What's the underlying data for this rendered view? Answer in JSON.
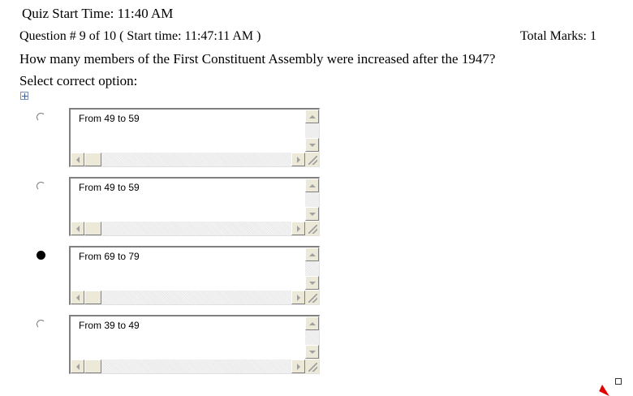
{
  "quiz": {
    "start_time_label": "Quiz Start Time: 11:40 AM"
  },
  "question": {
    "header": "Question # 9 of 10 ( Start time: 11:47:11 AM )",
    "total_marks": "Total Marks: 1",
    "text": "How many members of the First Constituent Assembly were increased after the 1947?",
    "select_label": "Select correct option:"
  },
  "options": [
    {
      "text": "From 49 to 59",
      "selected": false
    },
    {
      "text": "From 49 to 59",
      "selected": false
    },
    {
      "text": "From 69 to 79",
      "selected": true
    },
    {
      "text": "From 39 to 49",
      "selected": false
    }
  ],
  "icons": {
    "move_handle": "move-cross-icon",
    "scroll_up": "arrow-up-icon",
    "scroll_down": "arrow-down-icon",
    "scroll_left": "arrow-left-icon",
    "scroll_right": "arrow-right-icon",
    "resize_handle": "resize-handle-icon",
    "pointer": "red-pointer-icon"
  },
  "colors": {
    "scroll_face": "#ece9d8",
    "selection_dot": "#000000",
    "pointer": "#e00000"
  }
}
